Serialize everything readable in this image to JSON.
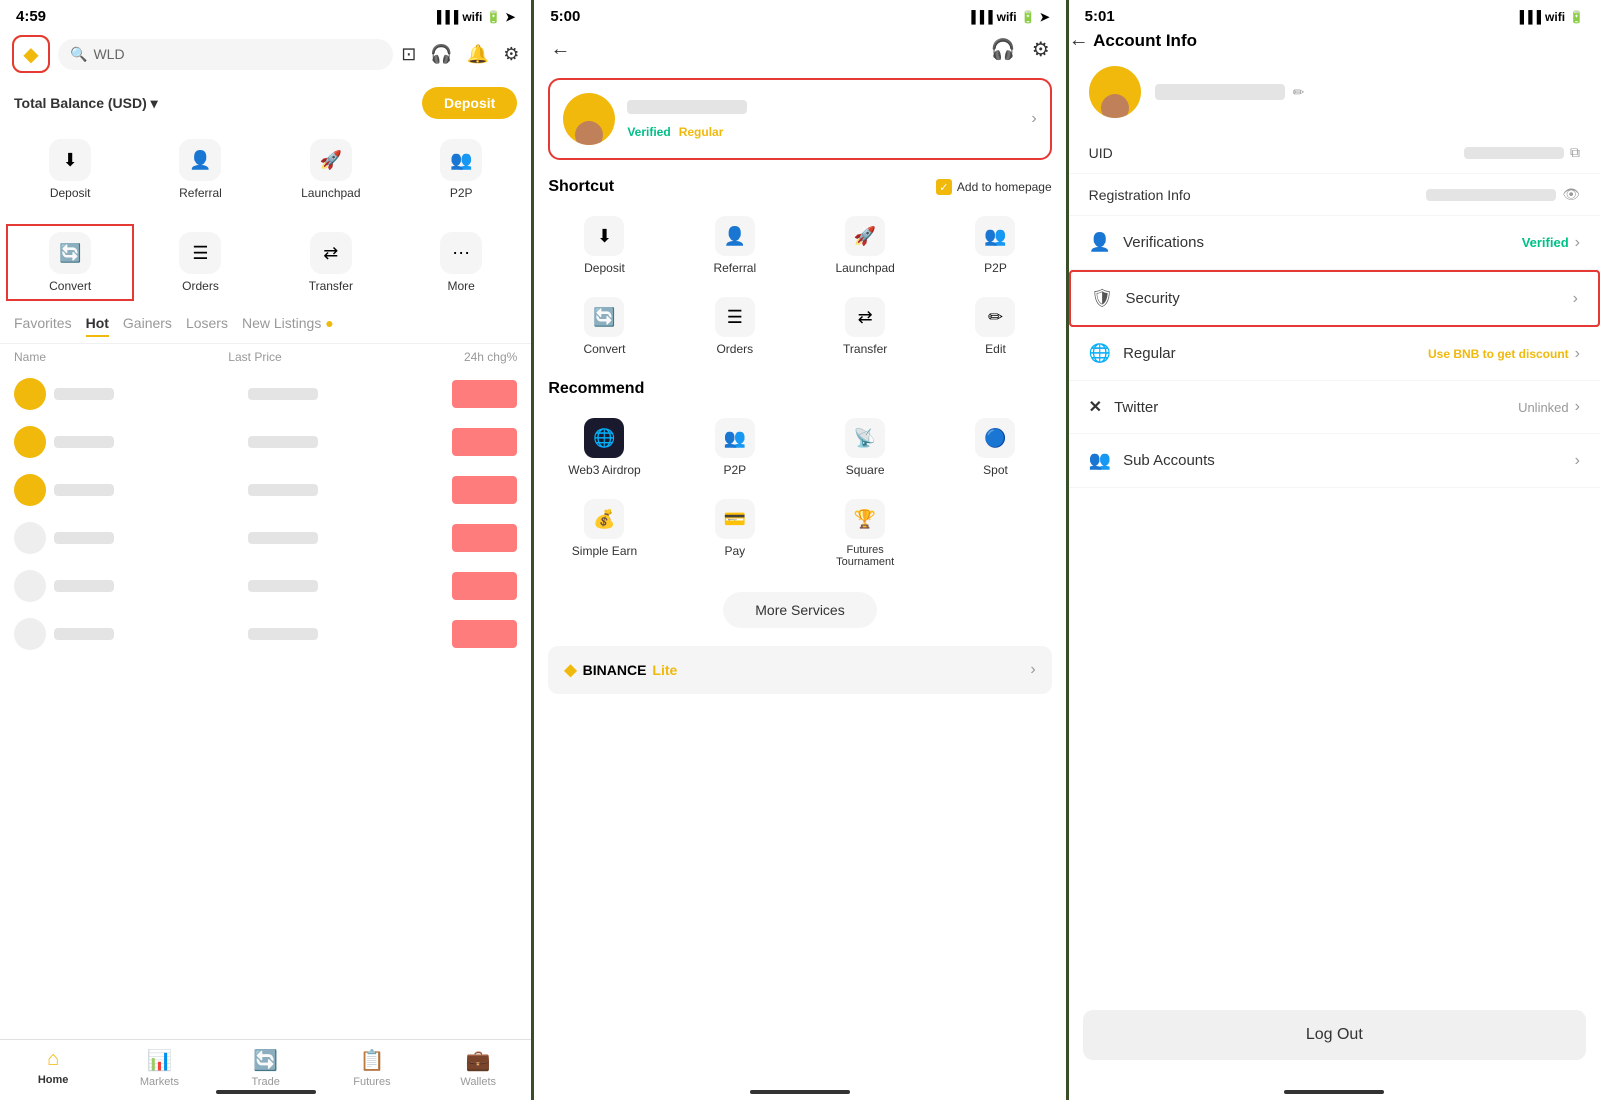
{
  "panel1": {
    "status_time": "4:59",
    "logo_symbol": "◆",
    "search_placeholder": "WLD",
    "balance_label": "Total Balance (USD) ▾",
    "deposit_label": "Deposit",
    "actions": [
      {
        "label": "Deposit",
        "icon": "⬇"
      },
      {
        "label": "Referral",
        "icon": "👤+"
      },
      {
        "label": "Launchpad",
        "icon": "🚀"
      },
      {
        "label": "P2P",
        "icon": "👥"
      }
    ],
    "actions2": [
      {
        "label": "Convert",
        "icon": "🔄"
      },
      {
        "label": "Orders",
        "icon": "☰"
      },
      {
        "label": "Transfer",
        "icon": "⇄"
      },
      {
        "label": "More",
        "icon": "⋯"
      }
    ],
    "tabs": [
      "Favorites",
      "Hot",
      "Gainers",
      "Losers",
      "New Listings"
    ],
    "active_tab": "Hot",
    "table_headers": [
      "Name",
      "Last Price",
      "24h chg%"
    ],
    "nav_items": [
      {
        "label": "Home",
        "icon": "⌂",
        "active": true
      },
      {
        "label": "Markets",
        "icon": "📊",
        "active": false
      },
      {
        "label": "Trade",
        "icon": "🔄",
        "active": false
      },
      {
        "label": "Futures",
        "icon": "📋",
        "active": false
      },
      {
        "label": "Wallets",
        "icon": "💼",
        "active": false
      }
    ]
  },
  "panel2": {
    "status_time": "5:00",
    "badges": {
      "verified": "Verified",
      "regular": "Regular"
    },
    "shortcut_title": "Shortcut",
    "add_homepage_label": "Add to homepage",
    "shortcuts": [
      {
        "label": "Deposit",
        "icon": "⬇"
      },
      {
        "label": "Referral",
        "icon": "👤+"
      },
      {
        "label": "Launchpad",
        "icon": "🚀"
      },
      {
        "label": "P2P",
        "icon": "👥"
      },
      {
        "label": "Convert",
        "icon": "🔄"
      },
      {
        "label": "Orders",
        "icon": "☰"
      },
      {
        "label": "Transfer",
        "icon": "⇄"
      },
      {
        "label": "Edit",
        "icon": "✏"
      }
    ],
    "recommend_title": "Recommend",
    "recommend_items": [
      {
        "label": "Web3 Airdrop",
        "icon": "🌐"
      },
      {
        "label": "P2P",
        "icon": "👥"
      },
      {
        "label": "Square",
        "icon": "📡"
      },
      {
        "label": "Spot",
        "icon": "🔵"
      },
      {
        "label": "Simple Earn",
        "icon": "💰"
      },
      {
        "label": "Pay",
        "icon": "💳"
      },
      {
        "label": "Futures\nTournament",
        "icon": "🏆"
      }
    ],
    "more_services_label": "More Services",
    "binance_lite_label": "BINANCE",
    "binance_lite_text": "Lite"
  },
  "panel3": {
    "status_time": "5:01",
    "page_title": "Account Info",
    "uid_label": "UID",
    "registration_label": "Registration Info",
    "verifications_label": "Verifications",
    "verified_status": "Verified",
    "security_label": "Security",
    "regular_label": "Regular",
    "regular_discount": "Use BNB to get discount",
    "twitter_label": "Twitter",
    "twitter_status": "Unlinked",
    "sub_accounts_label": "Sub Accounts",
    "logout_label": "Log Out"
  }
}
